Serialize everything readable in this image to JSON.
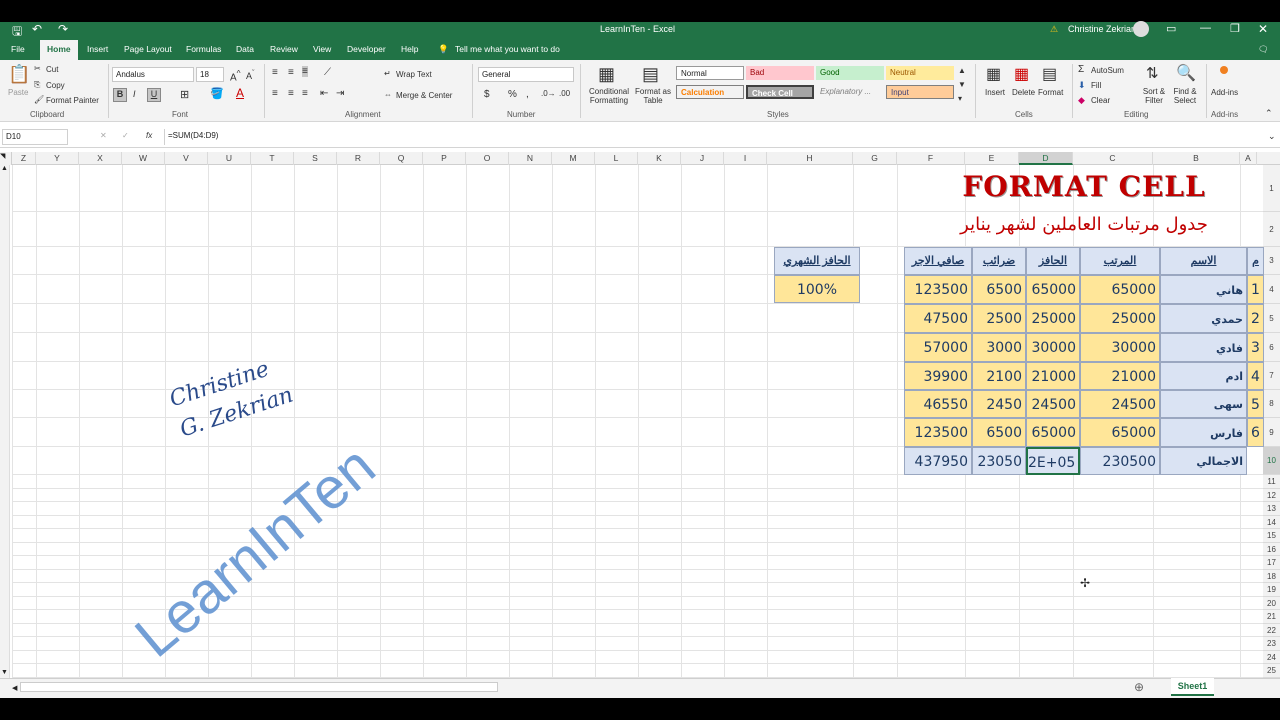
{
  "window": {
    "title": "LearnInTen  -  Excel",
    "user": "Christine Zekrian"
  },
  "tabs": [
    "File",
    "Home",
    "Insert",
    "Page Layout",
    "Formulas",
    "Data",
    "Review",
    "View",
    "Developer",
    "Help"
  ],
  "tell_me": "Tell me what you want to do",
  "clipboard": {
    "paste": "Paste",
    "cut": "Cut",
    "copy": "Copy",
    "format_painter": "Format Painter",
    "label": "Clipboard"
  },
  "font": {
    "name": "Andalus",
    "size": "18",
    "label": "Font",
    "bold": "B",
    "italic": "I",
    "underline": "U"
  },
  "alignment": {
    "wrap": "Wrap Text",
    "merge": "Merge & Center",
    "label": "Alignment"
  },
  "number": {
    "format": "General",
    "label": "Number",
    "currency": "$",
    "percent": "%",
    "comma": ","
  },
  "styles": {
    "label": "Styles",
    "conditional": "Conditional Formatting",
    "format_table": "Format as Table",
    "items": [
      "Normal",
      "Bad",
      "Good",
      "Neutral",
      "Calculation",
      "Check Cell",
      "Explanatory ...",
      "Input"
    ]
  },
  "cells": {
    "insert": "Insert",
    "delete": "Delete",
    "format": "Format",
    "label": "Cells"
  },
  "editing": {
    "autosum": "AutoSum",
    "fill": "Fill",
    "clear": "Clear",
    "sort": "Sort & Filter",
    "find": "Find & Select",
    "label": "Editing"
  },
  "addins": {
    "label": "Add-ins",
    "button": "Add-ins"
  },
  "formula_bar": {
    "name_box": "D10",
    "formula": "=SUM(D4:D9)",
    "fx": "fx"
  },
  "columns": [
    "Z",
    "Y",
    "X",
    "W",
    "V",
    "U",
    "T",
    "S",
    "R",
    "Q",
    "P",
    "O",
    "N",
    "M",
    "L",
    "K",
    "J",
    "I",
    "H",
    "G",
    "F",
    "E",
    "D",
    "C",
    "B",
    "A"
  ],
  "rows": [
    "1",
    "2",
    "3",
    "4",
    "5",
    "6",
    "7",
    "8",
    "9",
    "10",
    "11",
    "12",
    "13",
    "14",
    "15",
    "16",
    "17",
    "18",
    "19",
    "20",
    "21",
    "22",
    "23",
    "24",
    "25"
  ],
  "sheet": {
    "title": "FORMAT CELL",
    "subtitle": "جدول مرتبات العاملين لشهر يناير",
    "headers": {
      "num": "م",
      "name": "الاسم",
      "salary": "المرتب",
      "bonus": "الحافز",
      "tax": "ضرائب",
      "net": "صافي الاجر",
      "bonus_pct": "الحافز الشهري"
    },
    "bonus_pct_value": "100%",
    "rows": [
      {
        "num": "1",
        "name": "هاني",
        "salary": "65000",
        "bonus": "65000",
        "tax": "6500",
        "net": "123500"
      },
      {
        "num": "2",
        "name": "حمدي",
        "salary": "25000",
        "bonus": "25000",
        "tax": "2500",
        "net": "47500"
      },
      {
        "num": "3",
        "name": "فادي",
        "salary": "30000",
        "bonus": "30000",
        "tax": "3000",
        "net": "57000"
      },
      {
        "num": "4",
        "name": "ادم",
        "salary": "21000",
        "bonus": "21000",
        "tax": "2100",
        "net": "39900"
      },
      {
        "num": "5",
        "name": "سهى",
        "salary": "24500",
        "bonus": "24500",
        "tax": "2450",
        "net": "46550"
      },
      {
        "num": "6",
        "name": "فارس",
        "salary": "65000",
        "bonus": "65000",
        "tax": "6500",
        "net": "123500"
      }
    ],
    "total": {
      "label": "الاجمالي",
      "salary": "230500",
      "bonus": "2E+05",
      "tax": "23050",
      "net": "437950"
    }
  },
  "watermark": {
    "signature_line1": "Christine",
    "signature_line2": "G. Zekrian",
    "logo": "LearnInTen"
  },
  "sheet_tab": "Sheet1"
}
